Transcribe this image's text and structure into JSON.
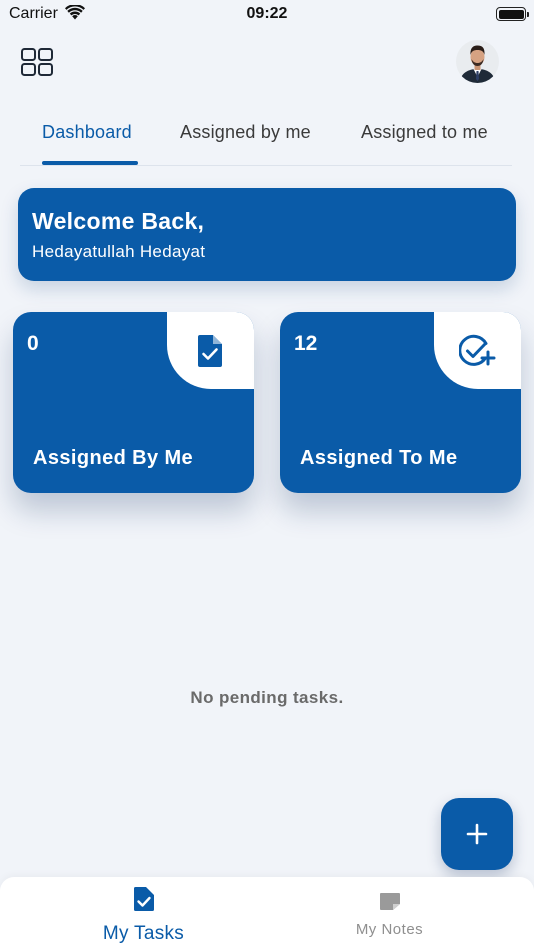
{
  "status_bar": {
    "carrier": "Carrier",
    "time": "09:22"
  },
  "header": {
    "menu_icon": "grid-icon",
    "avatar_alt": "profile-photo"
  },
  "tabs": [
    {
      "label": "Dashboard",
      "active": true
    },
    {
      "label": "Assigned by me",
      "active": false
    },
    {
      "label": "Assigned to me",
      "active": false
    }
  ],
  "welcome": {
    "title": "Welcome Back,",
    "name": "Hedayatullah Hedayat"
  },
  "stats": {
    "assigned_by_me": {
      "count": "0",
      "label": "Assigned By Me",
      "icon": "document-check-icon"
    },
    "assigned_to_me": {
      "count": "12",
      "label": "Assigned To Me",
      "icon": "circle-check-plus-icon"
    }
  },
  "empty_state": "No pending tasks.",
  "fab_icon": "plus-icon",
  "bottom_nav": [
    {
      "label": "My Tasks",
      "icon": "task-document-icon",
      "active": true
    },
    {
      "label": "My Notes",
      "icon": "note-icon",
      "active": false
    }
  ],
  "colors": {
    "primary": "#0a5ba8",
    "background": "#f1f4f9",
    "inactive": "#8f8f8f"
  }
}
